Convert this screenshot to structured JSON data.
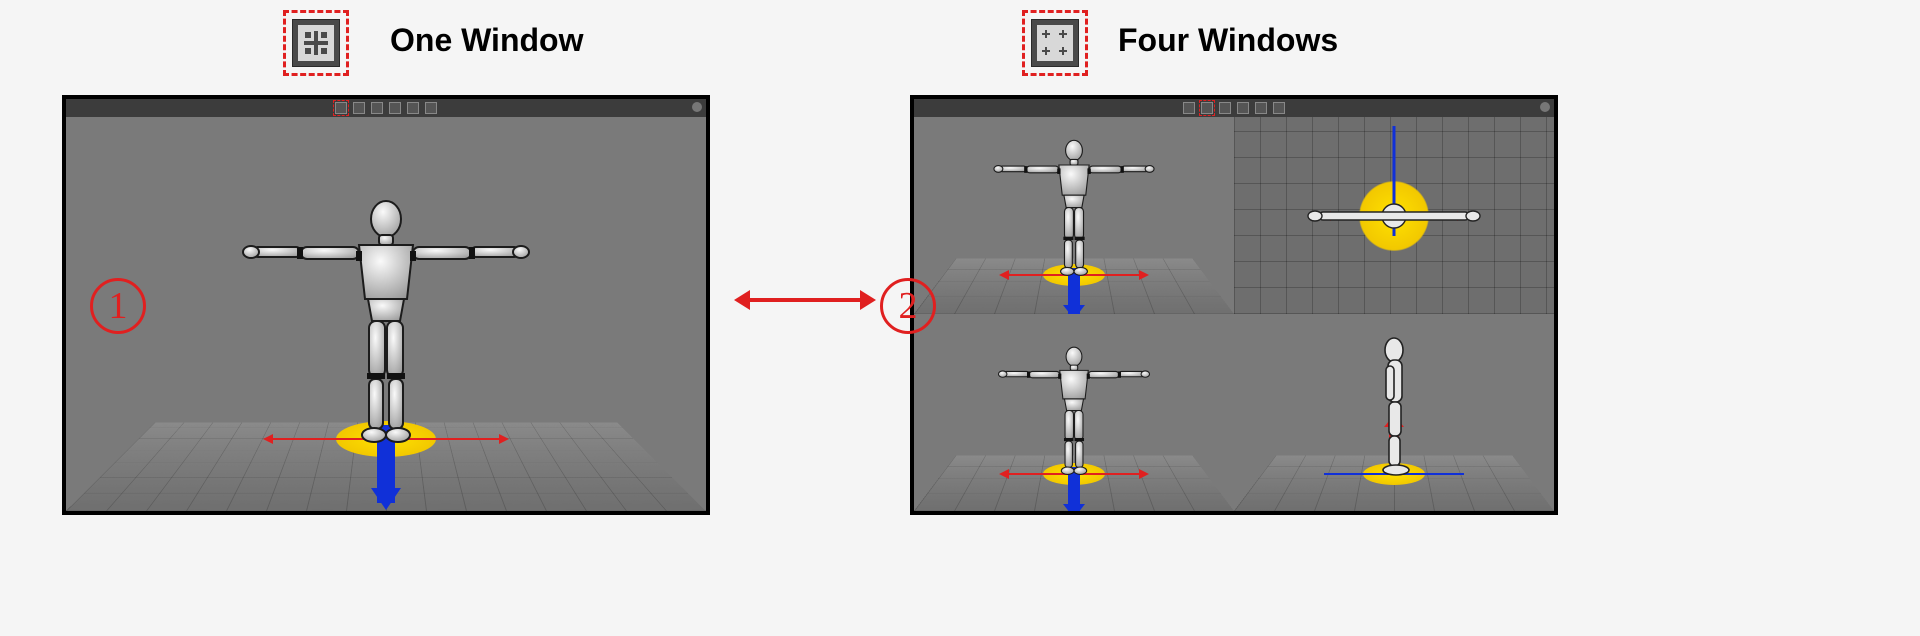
{
  "left": {
    "icon_name": "one-window-icon",
    "label": "One Window",
    "marker": "1"
  },
  "right": {
    "icon_name": "four-windows-icon",
    "label": "Four Windows",
    "marker": "2"
  },
  "toolbar_buttons": [
    "layout-one",
    "layout-four",
    "tool-a",
    "tool-b",
    "tool-c",
    "tool-d"
  ],
  "colors": {
    "accent_red": "#e02020",
    "axis_blue": "#1030d8",
    "gizmo_yellow": "#f2c800"
  }
}
